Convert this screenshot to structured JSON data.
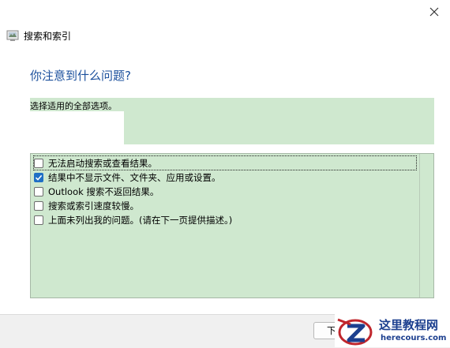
{
  "window": {
    "title": "搜索和索引",
    "app_icon": "search-indexing-icon",
    "close_icon": "close-icon"
  },
  "main": {
    "heading": "你注意到什么问题?",
    "hint": "选择适用的全部选项。",
    "options": [
      {
        "label": "无法启动搜索或查看结果。",
        "checked": false,
        "focused": true
      },
      {
        "label": "结果中不显示文件、文件夹、应用或设置。",
        "checked": true,
        "focused": false
      },
      {
        "label": "Outlook 搜索不返回结果。",
        "checked": false,
        "focused": false
      },
      {
        "label": "搜索或索引速度较慢。",
        "checked": false,
        "focused": false
      },
      {
        "label": "上面未列出我的问题。(请在下一页提供描述。)",
        "checked": false,
        "focused": false
      }
    ]
  },
  "footer": {
    "next_label": "下"
  },
  "watermark": {
    "cn": "这里教程网",
    "en": "herecours.com"
  },
  "colors": {
    "highlight": "#cfe8cf",
    "heading": "#1a4f9c",
    "checkbox_accent": "#1f6fc5"
  }
}
